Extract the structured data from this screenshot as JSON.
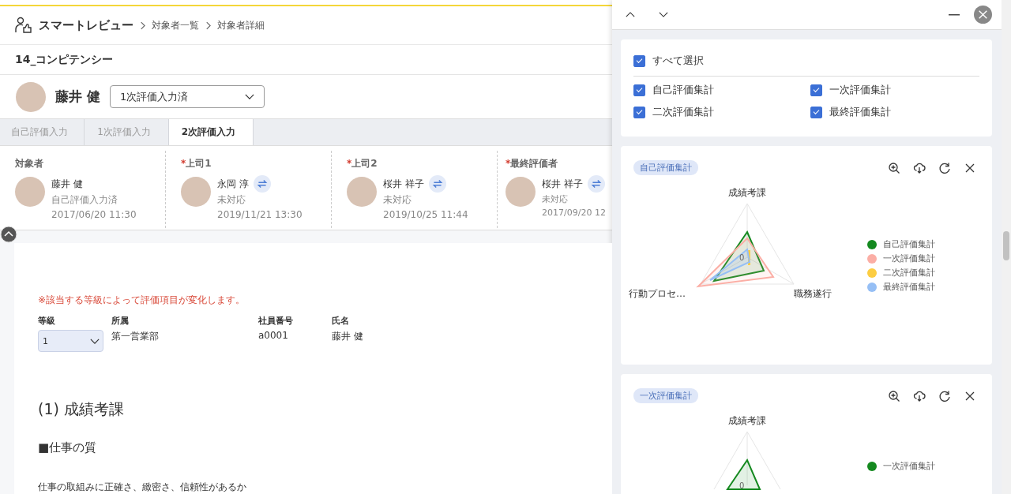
{
  "header": {
    "app_title": "スマートレビュー",
    "breadcrumbs": [
      "対象者一覧",
      "対象者詳細"
    ]
  },
  "page_title": "14_コンピテンシー",
  "person": {
    "name": "藤井 健",
    "status_select": "1次評価入力済"
  },
  "steps": [
    {
      "label": "自己評価入力",
      "selected": false
    },
    {
      "label": "1次評価入力",
      "selected": false
    },
    {
      "label": "2次評価入力",
      "selected": true
    }
  ],
  "evaluators": [
    {
      "role": "対象者",
      "name": "藤井 健",
      "swap": false,
      "status": "自己評価入力済",
      "date": "2017/06/20 11:30"
    },
    {
      "required_mark": "*",
      "role": "上司1",
      "name": "永岡 淳",
      "swap": true,
      "status": "未対応",
      "date": "2019/11/21 13:30"
    },
    {
      "required_mark": "*",
      "role": "上司2",
      "name": "桜井 祥子",
      "swap": true,
      "status": "未対応",
      "date": "2019/10/25 11:44"
    },
    {
      "required_mark": "*",
      "role": "最終評価者",
      "name": "桜井 祥子",
      "swap": true,
      "status": "未対応",
      "date": "2017/09/20 12"
    }
  ],
  "form": {
    "notice": "※該当する等級によって評価項目が変化します。",
    "fields": [
      {
        "label": "等級",
        "kind": "select",
        "value": "1"
      },
      {
        "label": "所属",
        "kind": "text",
        "value": "第一営業部"
      },
      {
        "label": "社員番号",
        "kind": "text",
        "value": "a0001"
      },
      {
        "label": "氏名",
        "kind": "text",
        "value": "藤井 健"
      }
    ],
    "section_title": "(1) 成績考課",
    "subsection": "■仕事の質",
    "question": "仕事の取組みに正確さ、緻密さ、信頼性があるか"
  },
  "panel": {
    "select_all": {
      "label": "すべて選択",
      "checked": true
    },
    "filters": [
      {
        "label": "自己評価集計",
        "checked": true
      },
      {
        "label": "一次評価集計",
        "checked": true
      },
      {
        "label": "二次評価集計",
        "checked": true
      },
      {
        "label": "最終評価集計",
        "checked": true
      }
    ],
    "charts": [
      {
        "tag": "自己評価集計",
        "axes": [
          "成績考課",
          "職務遂行",
          "行動プロセ…"
        ],
        "zero_label": "0",
        "legend": [
          {
            "label": "自己評価集計",
            "color": "#14891f"
          },
          {
            "label": "一次評価集計",
            "color": "#fbaea5"
          },
          {
            "label": "二次評価集計",
            "color": "#fccd42"
          },
          {
            "label": "最終評価集計",
            "color": "#96bff5"
          }
        ]
      },
      {
        "tag": "一次評価集計",
        "axes": [
          "成績考課"
        ],
        "zero_label": "0",
        "legend": [
          {
            "label": "一次評価集計",
            "color": "#14891f"
          }
        ]
      }
    ]
  }
}
